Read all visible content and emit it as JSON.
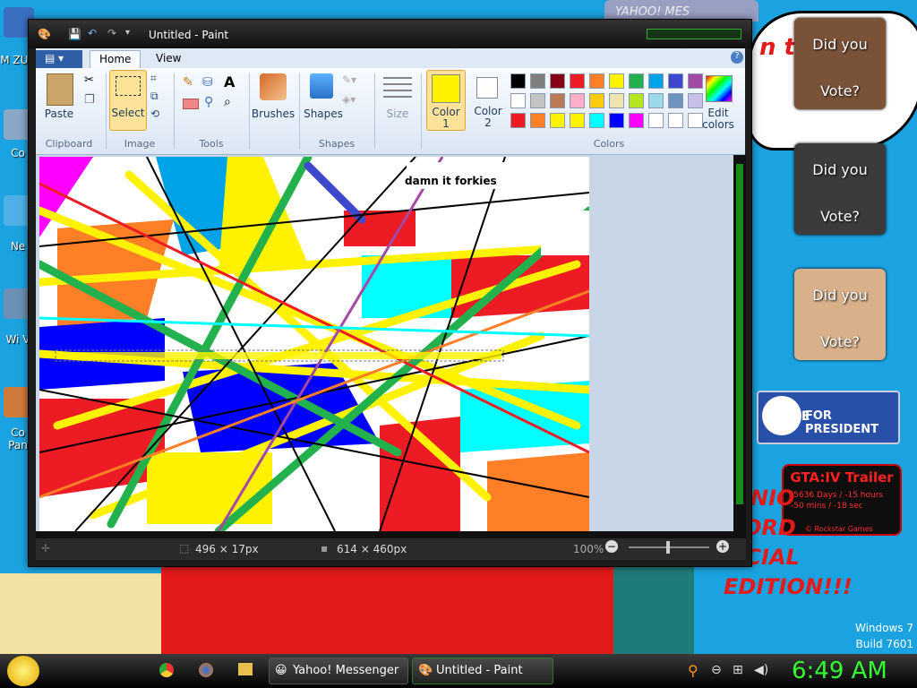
{
  "desktop": {
    "icons": [
      {
        "label": "M ZUC",
        "color": "#3a6fc2"
      },
      {
        "label": "Co",
        "color": "#8aa6c8"
      },
      {
        "label": "Ne",
        "color": "#4fb0e8"
      },
      {
        "label": "Wi V",
        "color": "#6b8fb5"
      },
      {
        "label": "Co Pan",
        "color": "#d07a3a"
      }
    ],
    "yahoo_tab": "YAHOO! MES",
    "cloud_text": "n t",
    "gadgets": [
      {
        "top": "Did you",
        "bottom": "Vote?",
        "bg": "#7a5238"
      },
      {
        "top": "Did you",
        "bottom": "Vote?",
        "bg": "#3b3b3b"
      },
      {
        "top": "Did you",
        "bottom": "Vote?",
        "bg": "#d8b08a"
      }
    ],
    "huckabee": {
      "left": "KABEE",
      "right": "FOR PRESIDENT"
    },
    "gta": {
      "title": "GTA:IV Trailer",
      "line1": "-5636 Days / -15 hours",
      "line2": "-50 mins / -18 sec",
      "credit": "© Rockstar Games"
    },
    "red_text": [
      "NIO",
      "ORD",
      "ECIAL",
      "EDITION!!!"
    ],
    "windows_version": "Windows 7",
    "build": "Build 7601"
  },
  "paint": {
    "title": "Untitled - Paint",
    "tabs": [
      "Home",
      "View"
    ],
    "tools": {
      "paste": "Paste",
      "select": "Select",
      "brushes": "Brushes",
      "shapes": "Shapes",
      "size": "Size",
      "color1": "Color 1",
      "color2": "Color 2",
      "edit_colors": "Edit colors"
    },
    "groups": {
      "clipboard": "Clipboard",
      "image": "Image",
      "tools": "Tools",
      "shapes": "Shapes",
      "colors": "Colors"
    },
    "palette_row1": [
      "#000000",
      "#7f7f7f",
      "#880015",
      "#ed1c24",
      "#ff7f27",
      "#fff200",
      "#22b14c",
      "#00a2e8",
      "#3f48cc",
      "#a349a4"
    ],
    "palette_row2": [
      "#ffffff",
      "#c3c3c3",
      "#b97a57",
      "#ffaec9",
      "#ffc90e",
      "#efe4b0",
      "#b5e61d",
      "#99d9ea",
      "#7092be",
      "#c8bfe7"
    ],
    "palette_row3": [
      "#ed1c24",
      "#ff7f27",
      "#fff200",
      "#fff200",
      "#00ffff",
      "#0000ff",
      "#ff00ff",
      "#ffffff",
      "#ffffff",
      "#ffffff"
    ],
    "color1_value": "#fff200",
    "color2_value": "#ffffff",
    "canvas_text": "damn it forkies",
    "status": {
      "selection": "496 × 17px",
      "image_size": "614 × 460px",
      "zoom": "100%"
    }
  },
  "taskbar": {
    "buttons": [
      "Yahoo! Messenger",
      "Untitled - Paint"
    ],
    "clock": "6:49 AM"
  }
}
